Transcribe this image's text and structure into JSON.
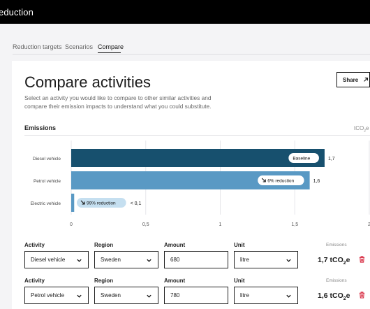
{
  "app": {
    "title": "eduction"
  },
  "tabs": [
    {
      "label": "Reduction targets"
    },
    {
      "label": "Scenarios"
    },
    {
      "label": "Compare",
      "active": true
    }
  ],
  "card": {
    "heading": "Compare activities",
    "description": "Select an activity you would like to compare to other similar activities and compare their emission impacts to understand what you could substitute.",
    "share_label": "Share",
    "emissions_label": "Emissions",
    "unit_label": "tCO",
    "unit_sub": "2",
    "unit_suffix": "e"
  },
  "chart_data": {
    "type": "bar",
    "orientation": "horizontal",
    "categories": [
      "Diesel vehicle",
      "Petrol vehicle",
      "Electric vehicle"
    ],
    "values": [
      1.7,
      1.6,
      0.02
    ],
    "value_labels": [
      "1,7",
      "1,6",
      "< 0,1"
    ],
    "badges": [
      "Baseline",
      "6% reduction",
      "99% reduction"
    ],
    "xlim": [
      0,
      2.0
    ],
    "xticks": [
      0,
      0.5,
      1,
      1.5,
      2
    ],
    "xtick_labels": [
      "0",
      "0,5",
      "1",
      "1,5",
      "2"
    ],
    "grid": true,
    "colors": {
      "baseline": "#17506e",
      "other": "#5999c4",
      "badge_bg": "#ffffff",
      "badge_bg_small": "#c5dff0"
    }
  },
  "columns": {
    "activity": "Activity",
    "region": "Region",
    "amount": "Amount",
    "unit": "Unit",
    "emissions": "Emissions"
  },
  "rows": [
    {
      "activity": "Diesel vehicle",
      "region": "Sweden",
      "amount": "680",
      "unit": "litre",
      "emission_value": "1,7 tCO",
      "emission_sub": "2",
      "emission_suffix": "e"
    },
    {
      "activity": "Petrol vehicle",
      "region": "Sweden",
      "amount": "780",
      "unit": "litre",
      "emission_value": "1,6 tCO",
      "emission_sub": "2",
      "emission_suffix": "e"
    }
  ],
  "theme": {
    "accent": "#000000",
    "danger": "#d7263d"
  }
}
